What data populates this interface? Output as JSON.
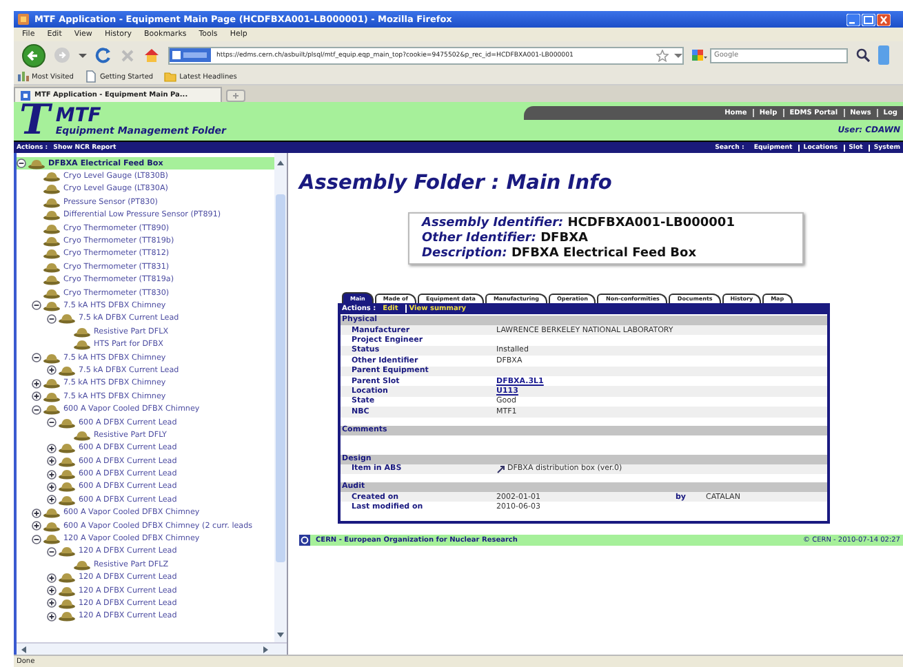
{
  "browser": {
    "title": "MTF Application - Equipment Main Page (HCDFBXA001-LB000001) - Mozilla Firefox",
    "menu": [
      "File",
      "Edit",
      "View",
      "History",
      "Bookmarks",
      "Tools",
      "Help"
    ],
    "url": "https://edms.cern.ch/asbuilt/plsql/mtf_equip.eqp_main_top?cookie=9475502&p_rec_id=HCDFBXA001-LB000001",
    "search_placeholder": "Google",
    "bookmarks": [
      "Most Visited",
      "Getting Started",
      "Latest Headlines"
    ],
    "tab_title": "MTF Application - Equipment Main Pa..."
  },
  "header": {
    "logo_mark": "T",
    "logo": "MTF",
    "subtitle": "Equipment Management Folder",
    "links": [
      "Home",
      "Help",
      "EDMS Portal",
      "News",
      "Log"
    ],
    "user": "User: CDAWN"
  },
  "nav_bar": {
    "actions_label": "Actions :",
    "actions": [
      "Show NCR Report"
    ],
    "search_label": "Search :",
    "search_links": [
      "Equipment",
      "Locations",
      "Slot",
      "System"
    ]
  },
  "tree": [
    {
      "label": "DFBXA Electrical Feed Box",
      "selected": true,
      "expanded": true,
      "children": [
        {
          "label": "Cryo Level Gauge (LT830B)",
          "selected": false
        },
        {
          "label": "Cryo Level Gauge (LT830A)",
          "selected": false
        },
        {
          "label": "Pressure Sensor (PT830)",
          "selected": false
        },
        {
          "label": "Differential Low Pressure Sensor (PT891)",
          "selected": false
        },
        {
          "label": "Cryo Thermometer (TT890)",
          "selected": false
        },
        {
          "label": "Cryo Thermometer (TT819b)",
          "selected": false
        },
        {
          "label": "Cryo Thermometer (TT812)",
          "selected": false
        },
        {
          "label": "Cryo Thermometer (TT831)",
          "selected": false
        },
        {
          "label": "Cryo Thermometer (TT819a)",
          "selected": false
        },
        {
          "label": "Cryo Thermometer (TT830)",
          "selected": false
        },
        {
          "label": "7.5 kA HTS DFBX Chimney",
          "selected": false,
          "expanded": true,
          "children": [
            {
              "label": "7.5 kA DFBX Current Lead",
              "selected": false,
              "expanded": true,
              "children": [
                {
                  "label": "Resistive Part DFLX",
                  "selected": false
                },
                {
                  "label": "HTS Part for DFBX",
                  "selected": false
                }
              ]
            }
          ]
        },
        {
          "label": "7.5 kA HTS DFBX Chimney",
          "selected": false,
          "expanded": true,
          "children": [
            {
              "label": "7.5 kA DFBX Current Lead",
              "selected": false,
              "expanded": false
            }
          ]
        },
        {
          "label": "7.5 kA HTS DFBX Chimney",
          "selected": false,
          "expanded": false
        },
        {
          "label": "7.5 kA HTS DFBX Chimney",
          "selected": false,
          "expanded": false
        },
        {
          "label": "600 A Vapor Cooled DFBX Chimney",
          "selected": false,
          "expanded": true,
          "children": [
            {
              "label": "600 A DFBX Current Lead",
              "selected": false,
              "expanded": true,
              "children": [
                {
                  "label": "Resistive Part DFLY",
                  "selected": false
                }
              ]
            },
            {
              "label": "600 A DFBX Current Lead",
              "selected": false,
              "expanded": false
            },
            {
              "label": "600 A DFBX Current Lead",
              "selected": false,
              "expanded": false
            },
            {
              "label": "600 A DFBX Current Lead",
              "selected": false,
              "expanded": false
            },
            {
              "label": "600 A DFBX Current Lead",
              "selected": false,
              "expanded": false
            },
            {
              "label": "600 A DFBX Current Lead",
              "selected": false,
              "expanded": false
            }
          ]
        },
        {
          "label": "600 A Vapor Cooled DFBX Chimney",
          "selected": false,
          "expanded": false
        },
        {
          "label": "600 A Vapor Cooled DFBX Chimney (2 curr. leads",
          "selected": false,
          "expanded": false
        },
        {
          "label": "120 A Vapor Cooled DFBX Chimney",
          "selected": false,
          "expanded": true,
          "children": [
            {
              "label": "120 A DFBX Current Lead",
              "selected": false,
              "expanded": true,
              "children": [
                {
                  "label": "Resistive Part DFLZ",
                  "selected": false
                }
              ]
            },
            {
              "label": "120 A DFBX Current Lead",
              "selected": false,
              "expanded": false
            },
            {
              "label": "120 A DFBX Current Lead",
              "selected": false,
              "expanded": false
            },
            {
              "label": "120 A DFBX Current Lead",
              "selected": false,
              "expanded": false
            },
            {
              "label": "120 A DFBX Current Lead",
              "selected": false,
              "expanded": false
            }
          ]
        }
      ]
    }
  ],
  "page_title": "Assembly Folder : Main Info",
  "identifiers": [
    {
      "label": "Assembly Identifier:",
      "value": "HCDFBXA001-LB000001"
    },
    {
      "label": "Other Identifier:",
      "value": "DFBXA"
    },
    {
      "label": "Description:",
      "value": "DFBXA Electrical Feed Box"
    }
  ],
  "tabs": [
    {
      "label": "Main",
      "selected": true
    },
    {
      "label": "Made of",
      "selected": false
    },
    {
      "label": "Equipment data",
      "selected": false
    },
    {
      "label": "Manufacturing",
      "selected": false
    },
    {
      "label": "Operation",
      "selected": false
    },
    {
      "label": "Non-conformities",
      "selected": false
    },
    {
      "label": "Documents",
      "selected": false
    },
    {
      "label": "History",
      "selected": false
    },
    {
      "label": "Map",
      "selected": false
    }
  ],
  "actions": {
    "label": "Actions :",
    "links": [
      "Edit",
      "View summary"
    ]
  },
  "sections": [
    {
      "title": "Physical",
      "rows": [
        {
          "label": "Manufacturer",
          "value": "LAWRENCE BERKELEY NATIONAL LABORATORY",
          "kind": "text"
        },
        {
          "label": "Project Engineer"
        },
        {
          "label": "Status",
          "value": "Installed",
          "kind": "text"
        },
        {
          "label": "Other Identifier",
          "value": "DFBXA",
          "kind": "text"
        },
        {
          "label": "Parent Equipment"
        },
        {
          "label": "Parent Slot",
          "value": "DFBXA.3L1",
          "kind": "link"
        },
        {
          "label": "Location",
          "value": "U113",
          "kind": "link"
        },
        {
          "label": "State",
          "value": "Good",
          "kind": "text"
        },
        {
          "label": "NBC",
          "value": "MTF1",
          "kind": "text"
        }
      ]
    },
    {
      "title": "Comments"
    },
    {
      "title": "Design",
      "rows": [
        {
          "label": "Item in ABS",
          "value": "DFBXA distribution box (ver.0)",
          "kind": "document"
        }
      ]
    },
    {
      "title": "Audit",
      "rows": [
        {
          "label": "Created on",
          "value": "2002-01-01",
          "kind": "text",
          "extra_label": "by",
          "extra_value": "CATALAN"
        },
        {
          "label": "Last modified on",
          "value": "2010-06-03",
          "kind": "text"
        }
      ]
    }
  ],
  "footer": {
    "left": "CERN - European Organization for Nuclear Research",
    "right": "© CERN - 2010-07-14 02:27"
  },
  "status_bar": "Done"
}
